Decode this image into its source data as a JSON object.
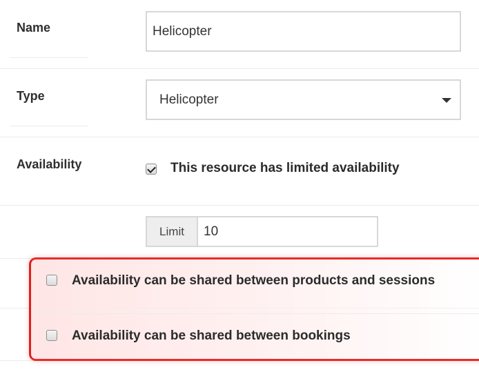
{
  "form": {
    "name": {
      "label": "Name",
      "value": "Helicopter"
    },
    "type": {
      "label": "Type",
      "selected": "Helicopter"
    },
    "availability": {
      "label": "Availability",
      "limited_checkbox": {
        "label": "This resource has limited availability",
        "checked": true
      },
      "limit": {
        "addon_label": "Limit",
        "value": "10"
      },
      "shared_products_sessions": {
        "label": "Availability can be shared between products and sessions",
        "checked": false
      },
      "shared_bookings": {
        "label": "Availability can be shared between bookings",
        "checked": false
      }
    }
  },
  "colors": {
    "highlight_border": "#e21d1d",
    "input_border": "#d7d7d7",
    "addon_background": "#eeeeee"
  }
}
